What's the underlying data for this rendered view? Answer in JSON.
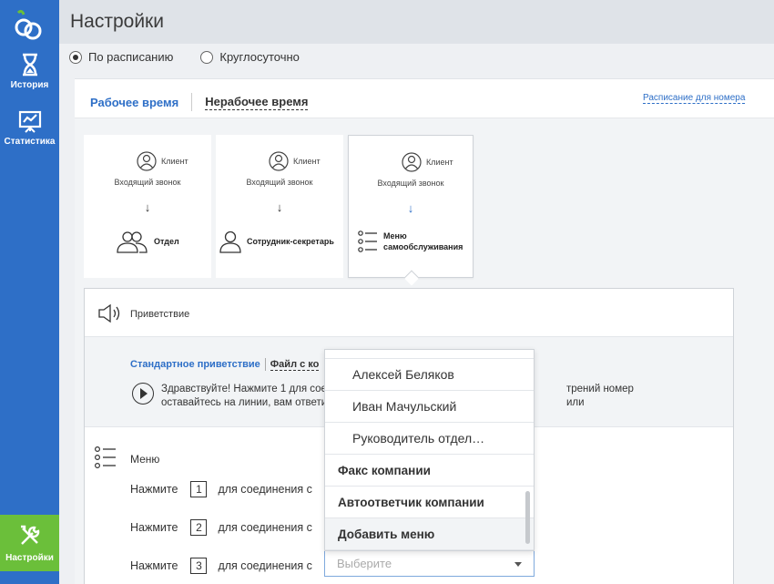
{
  "sidebar": {
    "history_label": "История",
    "stats_label": "Статистика",
    "settings_label": "Настройки"
  },
  "header": {
    "title": "Настройки"
  },
  "mode": {
    "schedule_label": "По расписанию",
    "allday_label": "Круглосуточно",
    "selected": "schedule"
  },
  "tabs": {
    "work_time": "Рабочее время",
    "nonwork_time": "Нерабочее время",
    "schedule_link": "Расписание для номера"
  },
  "cards": [
    {
      "client": "Клиент",
      "incoming": "Входящий звонок",
      "arrow": "↓",
      "target": "Отдел"
    },
    {
      "client": "Клиент",
      "incoming": "Входящий звонок",
      "arrow": "↓",
      "target": "Сотрудник-секретарь"
    },
    {
      "client": "Клиент",
      "incoming": "Входящий звонок",
      "arrow": "↓",
      "target_line1": "Меню",
      "target_line2": "самообслуживания"
    }
  ],
  "greeting": {
    "label": "Приветствие",
    "tab_standard": "Стандартное приветствие",
    "tab_file": "Файл с ко",
    "text_line1_start": "Здравствуйте! Нажмите 1 для соеди",
    "text_line1_end": "трений номер или",
    "text_line2": "оставайтесь на линии, вам ответи"
  },
  "menu": {
    "label": "Меню",
    "rows": [
      {
        "press": "Нажмите",
        "num": "1",
        "suffix": "для соединения с"
      },
      {
        "press": "Нажмите",
        "num": "2",
        "suffix": "для соединения с"
      },
      {
        "press": "Нажмите",
        "num": "3",
        "suffix": "для соединения с"
      }
    ]
  },
  "dropdown": {
    "options": [
      "Алексей Беляков",
      "Иван Мачульский",
      "Руководитель отдел…"
    ],
    "bold_options": [
      "Факс компании",
      "Автоответчик компании",
      "Добавить меню"
    ],
    "placeholder": "Выберите"
  },
  "colors": {
    "sidebar": "#2e6fc7",
    "accent": "#2e6fc7",
    "settings_active": "#6bbf3a"
  }
}
